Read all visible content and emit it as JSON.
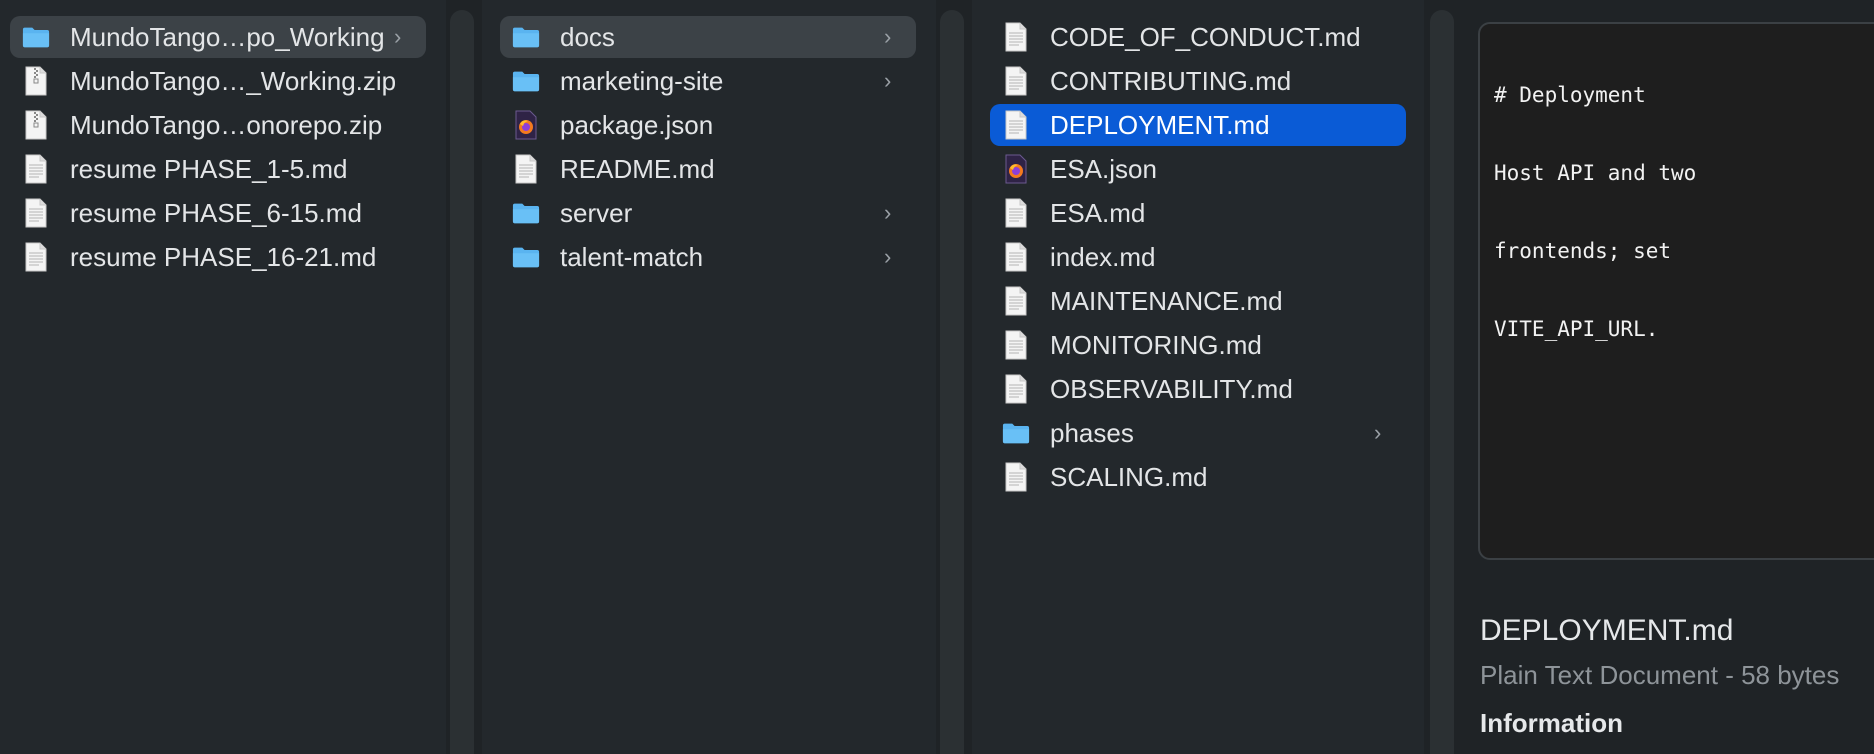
{
  "columns": [
    {
      "items": [
        {
          "label": "MundoTango…po_Working",
          "icon": "folder-icon",
          "chevron": "›",
          "selected": "gray"
        },
        {
          "label": "MundoTango…_Working.zip",
          "icon": "zip-file-icon"
        },
        {
          "label": "MundoTango…onorepo.zip",
          "icon": "zip-file-icon"
        },
        {
          "label": "resume PHASE_1-5.md",
          "icon": "document-icon"
        },
        {
          "label": "resume PHASE_6-15.md",
          "icon": "document-icon"
        },
        {
          "label": "resume PHASE_16-21.md",
          "icon": "document-icon"
        }
      ]
    },
    {
      "items": [
        {
          "label": "docs",
          "icon": "folder-icon",
          "chevron": "›",
          "selected": "gray"
        },
        {
          "label": "marketing-site",
          "icon": "folder-icon",
          "chevron": "›"
        },
        {
          "label": "package.json",
          "icon": "firefox-document-icon"
        },
        {
          "label": "README.md",
          "icon": "document-icon"
        },
        {
          "label": "server",
          "icon": "folder-icon",
          "chevron": "›"
        },
        {
          "label": "talent-match",
          "icon": "folder-icon",
          "chevron": "›"
        }
      ]
    },
    {
      "items": [
        {
          "label": "CODE_OF_CONDUCT.md",
          "icon": "document-icon"
        },
        {
          "label": "CONTRIBUTING.md",
          "icon": "document-icon"
        },
        {
          "label": "DEPLOYMENT.md",
          "icon": "document-icon",
          "selected": "blue"
        },
        {
          "label": "ESA.json",
          "icon": "firefox-document-icon"
        },
        {
          "label": "ESA.md",
          "icon": "document-icon"
        },
        {
          "label": "index.md",
          "icon": "document-icon"
        },
        {
          "label": "MAINTENANCE.md",
          "icon": "document-icon"
        },
        {
          "label": "MONITORING.md",
          "icon": "document-icon"
        },
        {
          "label": "OBSERVABILITY.md",
          "icon": "document-icon"
        },
        {
          "label": "phases",
          "icon": "folder-icon",
          "chevron": "›"
        },
        {
          "label": "SCALING.md",
          "icon": "document-icon"
        }
      ]
    }
  ],
  "preview": {
    "lines": [
      "# Deployment",
      "Host API and two",
      "frontends; set",
      "VITE_API_URL."
    ],
    "file_name": "DEPLOYMENT.md",
    "kind_size": "Plain Text Document - 58 bytes",
    "info_heading": "Information"
  },
  "colors": {
    "background": "#23282c",
    "selection_gray": "#3c4247",
    "selection_blue": "#0a5bd6",
    "folder": "#5ab4f0"
  }
}
